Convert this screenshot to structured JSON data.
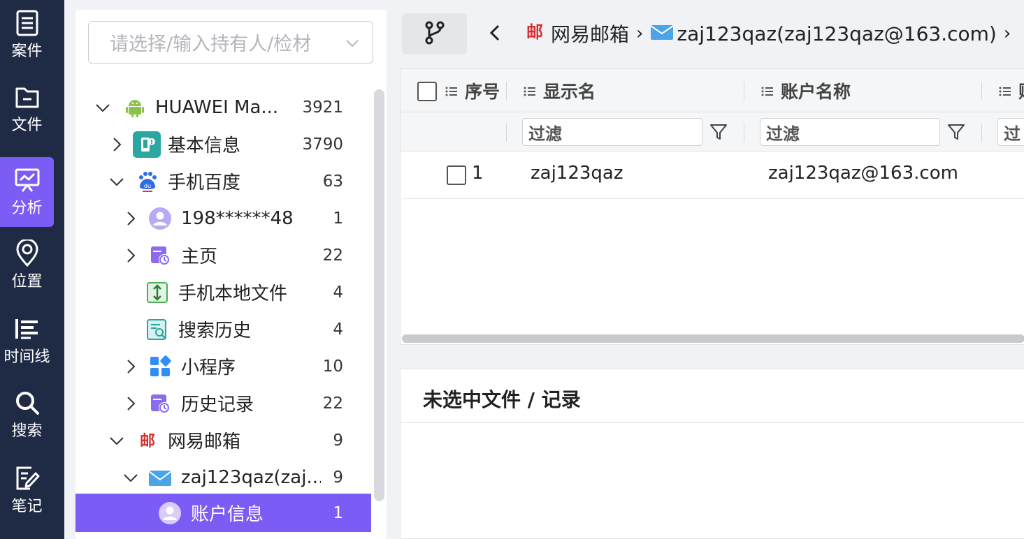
{
  "nav": {
    "items": [
      {
        "label": "案件",
        "icon": "case-icon"
      },
      {
        "label": "文件",
        "icon": "folder-icon"
      },
      {
        "label": "分析",
        "icon": "analysis-icon"
      },
      {
        "label": "位置",
        "icon": "location-pin-icon"
      },
      {
        "label": "时间线",
        "icon": "timeline-icon"
      },
      {
        "label": "搜索",
        "icon": "search-icon"
      },
      {
        "label": "笔记",
        "icon": "note-icon"
      }
    ],
    "active": "分析",
    "accent": "#7b5cf5",
    "background": "#1f2a44"
  },
  "tree": {
    "owner_select": {
      "placeholder": "请选择/输入持有人/检材"
    },
    "items": [
      {
        "label": "HUAWEI Ma...",
        "count": "3921",
        "icon": "android-icon"
      },
      {
        "label": "基本信息",
        "count": "3790",
        "icon": "device-info-icon"
      },
      {
        "label": "手机百度",
        "count": "63",
        "icon": "baidu-icon"
      },
      {
        "label": "198******48",
        "count": "1",
        "icon": "user-avatar-icon"
      },
      {
        "label": "主页",
        "count": "22",
        "icon": "calendar-clock-icon"
      },
      {
        "label": "手机本地文件",
        "count": "4",
        "icon": "local-file-icon"
      },
      {
        "label": "搜索历史",
        "count": "4",
        "icon": "search-history-icon"
      },
      {
        "label": "小程序",
        "count": "10",
        "icon": "mini-program-icon"
      },
      {
        "label": "历史记录",
        "count": "22",
        "icon": "calendar-clock-icon"
      },
      {
        "label": "网易邮箱",
        "count": "9",
        "icon": "netease-mail-icon"
      },
      {
        "label": "zaj123qaz(zaj...",
        "count": "9",
        "icon": "mail-envelope-icon"
      },
      {
        "label": "账户信息",
        "count": "1",
        "icon": "user-avatar-icon"
      }
    ]
  },
  "toolbar": {
    "breadcrumb": [
      {
        "label": "网易邮箱",
        "icon": "netease-mail-icon"
      },
      {
        "label": "zaj123qaz(zaj123qaz@163.com)",
        "icon": "mail-envelope-icon"
      }
    ]
  },
  "grid": {
    "columns": [
      "序号",
      "显示名",
      "账户名称",
      "账"
    ],
    "filter_placeholder": "过滤",
    "filter_visible_partial": "过",
    "rows": [
      {
        "index": "1",
        "display_name": "zaj123qaz",
        "account_name": "zaj123qaz@163.com"
      }
    ]
  },
  "detail": {
    "title": "未选中文件 / 记录"
  }
}
